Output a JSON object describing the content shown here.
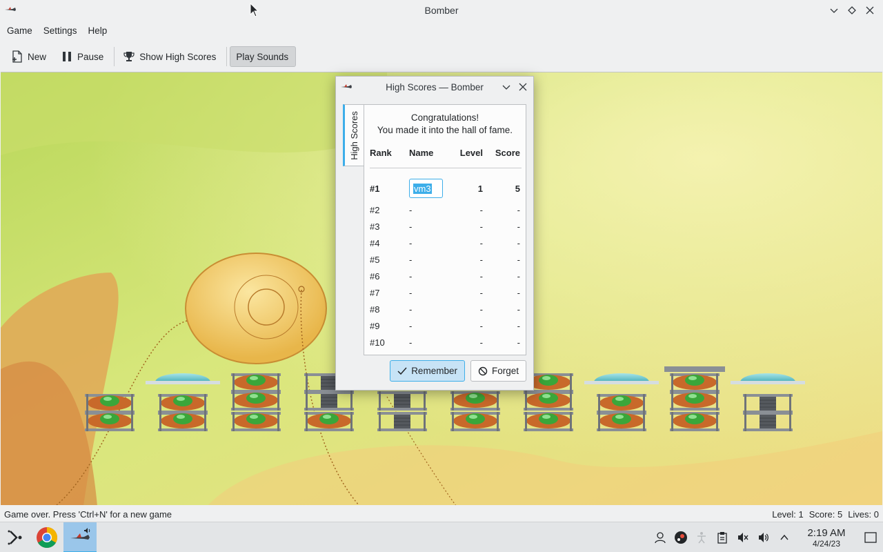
{
  "window": {
    "title": "Bomber",
    "icon": "bomber-plane-icon"
  },
  "menu": [
    "Game",
    "Settings",
    "Help"
  ],
  "toolbar": {
    "new_label": "New",
    "pause_label": "Pause",
    "show_high_scores_label": "Show High Scores",
    "play_sounds_label": "Play Sounds"
  },
  "statusbar": {
    "message": "Game over. Press 'Ctrl+N' for a new game",
    "level": "Level: 1",
    "score": "Score: 5",
    "lives": "Lives: 0"
  },
  "dialog": {
    "title": "High Scores — Bomber",
    "tab_label": "High Scores",
    "congrats_line1": "Congratulations!",
    "congrats_line2": "You made it into the hall of fame.",
    "headers": {
      "rank": "Rank",
      "name": "Name",
      "level": "Level",
      "score": "Score"
    },
    "rows": [
      {
        "rank": "#1",
        "name": "vm3",
        "level": "1",
        "score": "5"
      },
      {
        "rank": "#2",
        "name": "-",
        "level": "-",
        "score": "-"
      },
      {
        "rank": "#3",
        "name": "-",
        "level": "-",
        "score": "-"
      },
      {
        "rank": "#4",
        "name": "-",
        "level": "-",
        "score": "-"
      },
      {
        "rank": "#5",
        "name": "-",
        "level": "-",
        "score": "-"
      },
      {
        "rank": "#6",
        "name": "-",
        "level": "-",
        "score": "-"
      },
      {
        "rank": "#7",
        "name": "-",
        "level": "-",
        "score": "-"
      },
      {
        "rank": "#8",
        "name": "-",
        "level": "-",
        "score": "-"
      },
      {
        "rank": "#9",
        "name": "-",
        "level": "-",
        "score": "-"
      },
      {
        "rank": "#10",
        "name": "-",
        "level": "-",
        "score": "-"
      }
    ],
    "remember_label": "Remember",
    "forget_label": "Forget"
  },
  "taskbar": {
    "time": "2:19 AM",
    "date": "4/24/23"
  },
  "colors": {
    "accent": "#3daee9",
    "window_bg": "#eff0f1",
    "panel_bg": "#fcfcfc"
  }
}
